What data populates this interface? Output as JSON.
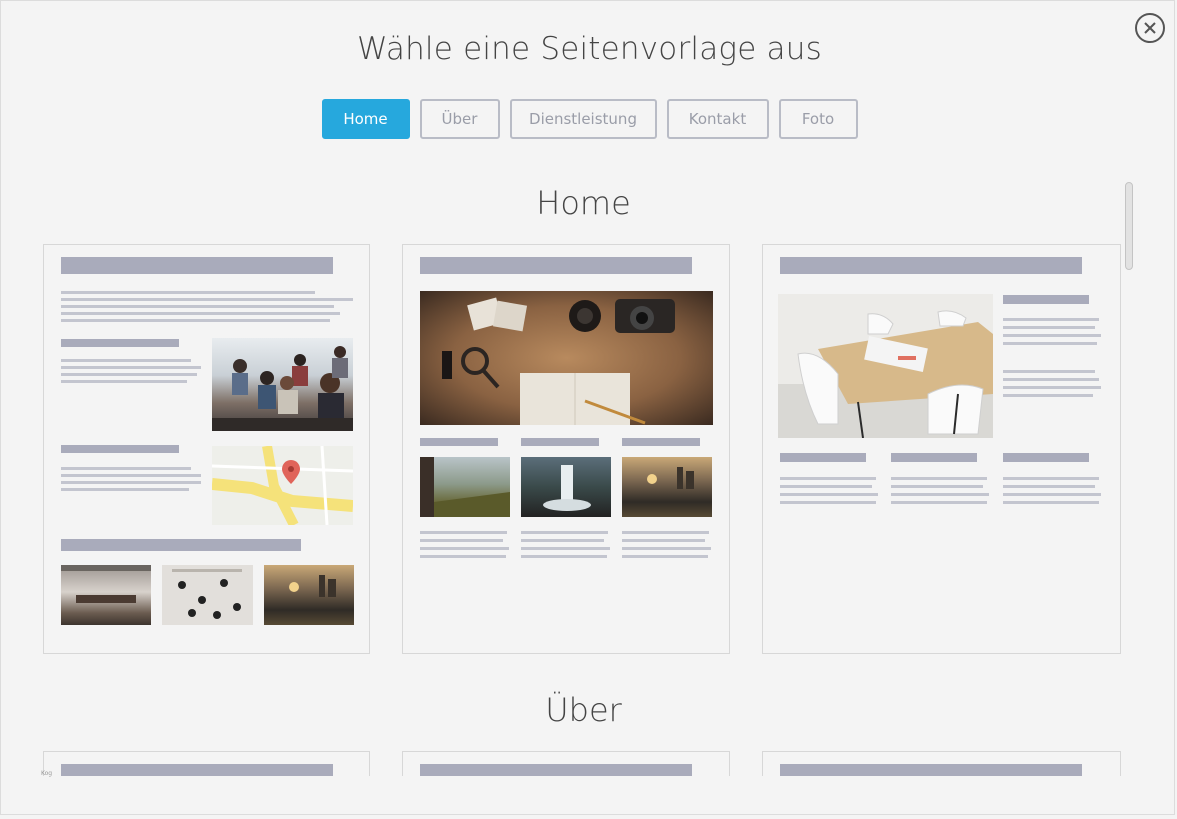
{
  "dialog": {
    "title": "Wähle eine Seitenvorlage aus",
    "close_icon": "close-icon"
  },
  "tabs": [
    {
      "label": "Home",
      "active": true
    },
    {
      "label": "Über",
      "active": false
    },
    {
      "label": "Dienstleistung",
      "active": false
    },
    {
      "label": "Kontakt",
      "active": false
    },
    {
      "label": "Foto",
      "active": false
    }
  ],
  "sections": [
    {
      "title": "Home"
    },
    {
      "title": "Über"
    }
  ],
  "colors": {
    "accent": "#26a8dd",
    "placeholder_bar": "#a9abbb",
    "placeholder_line": "#c3c5cf"
  },
  "footer": {
    "tag": "Kog"
  }
}
